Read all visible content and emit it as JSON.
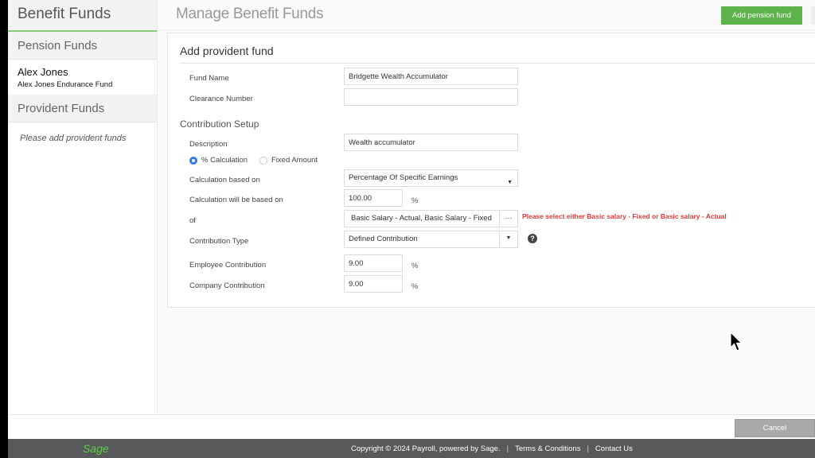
{
  "sidebar": {
    "title": "Benefit Funds",
    "pension_section": "Pension Funds",
    "pension_funds": [
      {
        "name": "Alex Jones",
        "fund": "Alex Jones Endurance Fund"
      }
    ],
    "provident_section": "Provident Funds",
    "provident_empty": "Please add provident funds"
  },
  "header": {
    "title": "Manage Benefit Funds",
    "add_pension_button": "Add pension fund"
  },
  "form": {
    "title": "Add provident fund",
    "fund_name": {
      "label": "Fund Name",
      "value": "Bridgette Wealth Accumulator"
    },
    "clearance_number": {
      "label": "Clearance Number",
      "value": ""
    },
    "contribution_setup_title": "Contribution Setup",
    "description": {
      "label": "Description",
      "value": "Wealth accumulator"
    },
    "calc_mode": {
      "options": [
        "% Calculation",
        "Fixed Amount"
      ],
      "selected": "% Calculation"
    },
    "calculation_based_on": {
      "label": "Calculation based on",
      "value": "Percentage Of Specific Earnings"
    },
    "calculation_will_be_based_on": {
      "label": "Calculation will be based on",
      "value": "100.00",
      "unit": "%"
    },
    "of": {
      "label": "of",
      "value": "Basic Salary - Actual, Basic Salary - Fixed",
      "button": "···",
      "error": "Please select either Basic salary - Fixed or Basic salary - Actual"
    },
    "contribution_type": {
      "label": "Contribution Type",
      "value": "Defined Contribution",
      "help": "?"
    },
    "employee_contribution": {
      "label": "Employee Contribution",
      "value": "9.00",
      "unit": "%"
    },
    "company_contribution": {
      "label": "Company Contribution",
      "value": "9.00",
      "unit": "%"
    }
  },
  "actions": {
    "cancel": "Cancel"
  },
  "footer": {
    "logo": "Sage",
    "copyright": "Copyright © 2024 Payroll, powered by Sage.",
    "terms": "Terms & Conditions",
    "contact": "Contact Us",
    "separator": "|"
  },
  "colors": {
    "accent_green": "#5fb34c",
    "error_red": "#e03a3a",
    "radio_blue": "#2f7de1",
    "footer_bg": "#58595b"
  }
}
